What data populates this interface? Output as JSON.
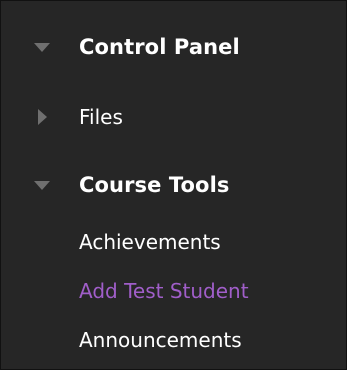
{
  "colors": {
    "background": "#262626",
    "text": "#ffffff",
    "visited_link": "#a05ec9",
    "toggle_arrow": "#6f6f6f"
  },
  "menu": {
    "control_panel": {
      "label": "Control Panel",
      "icon": "triangle-down-icon"
    },
    "files": {
      "label": "Files",
      "icon": "triangle-right-icon"
    },
    "course_tools": {
      "label": "Course Tools",
      "icon": "triangle-down-icon",
      "items": [
        {
          "label": "Achievements"
        },
        {
          "label": "Add Test Student"
        },
        {
          "label": "Announcements"
        }
      ]
    }
  }
}
